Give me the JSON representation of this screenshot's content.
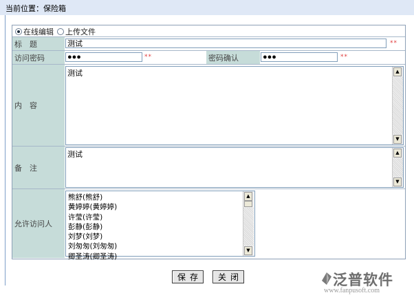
{
  "breadcrumb": "当前位置：保险箱",
  "mode": {
    "options": [
      {
        "label": "在线编辑",
        "selected": true
      },
      {
        "label": "上传文件",
        "selected": false
      }
    ]
  },
  "form": {
    "title_label": "标　题",
    "title_value": "测试",
    "title_required": "**",
    "password_label": "访问密码",
    "password_value": "●●●",
    "password_required": "**",
    "confirm_label": "密码确认",
    "confirm_value": "●●●",
    "confirm_required": "**",
    "content_label": "内　容",
    "content_value": "测试",
    "remark_label": "备　注",
    "remark_value": "测试",
    "visitors_label": "允许访问人",
    "visitors": [
      "熊舒(熊舒)",
      "黄婷婷(黄婷婷)",
      "许莹(许莹)",
      "彭静(彭静)",
      "刘梦(刘梦)",
      "刘匆匆(刘匆匆)",
      "卿圣涛(卿圣涛)"
    ]
  },
  "actions": {
    "save_label": "保存",
    "close_label": "关闭"
  },
  "logo": {
    "brand": "泛普软件",
    "url": "www.fanpusoft.com"
  }
}
